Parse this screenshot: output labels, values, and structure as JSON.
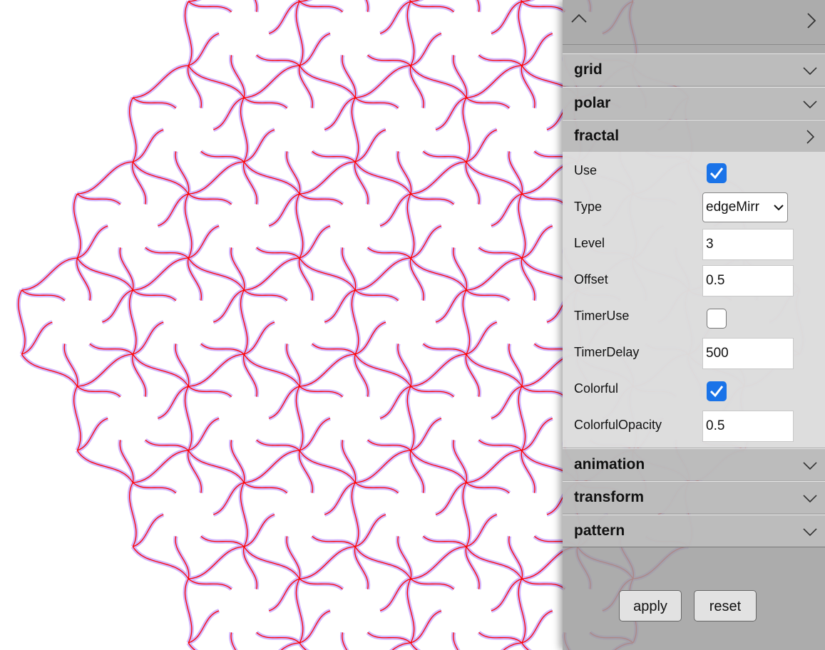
{
  "panel": {
    "sections": {
      "grid": {
        "title": "grid"
      },
      "polar": {
        "title": "polar"
      },
      "fractal": {
        "title": "fractal"
      },
      "animation": {
        "title": "animation"
      },
      "transform": {
        "title": "transform"
      },
      "pattern": {
        "title": "pattern"
      }
    },
    "fractal": {
      "use": {
        "label": "Use",
        "checked": true
      },
      "type": {
        "label": "Type",
        "value": "edgeMirr"
      },
      "level": {
        "label": "Level",
        "value": "3"
      },
      "offset": {
        "label": "Offset",
        "value": "0.5"
      },
      "timer_use": {
        "label": "TimerUse",
        "checked": false
      },
      "timer_delay": {
        "label": "TimerDelay",
        "value": "500"
      },
      "colorful": {
        "label": "Colorful",
        "checked": true
      },
      "colorful_opacity": {
        "label": "ColorfulOpacity",
        "value": "0.5"
      }
    },
    "buttons": {
      "apply": "apply",
      "reset": "reset"
    }
  },
  "colors": {
    "stroke": "#ff0000",
    "fill_accent": "#7b2ff7",
    "checkbox": "#1a73e8"
  }
}
